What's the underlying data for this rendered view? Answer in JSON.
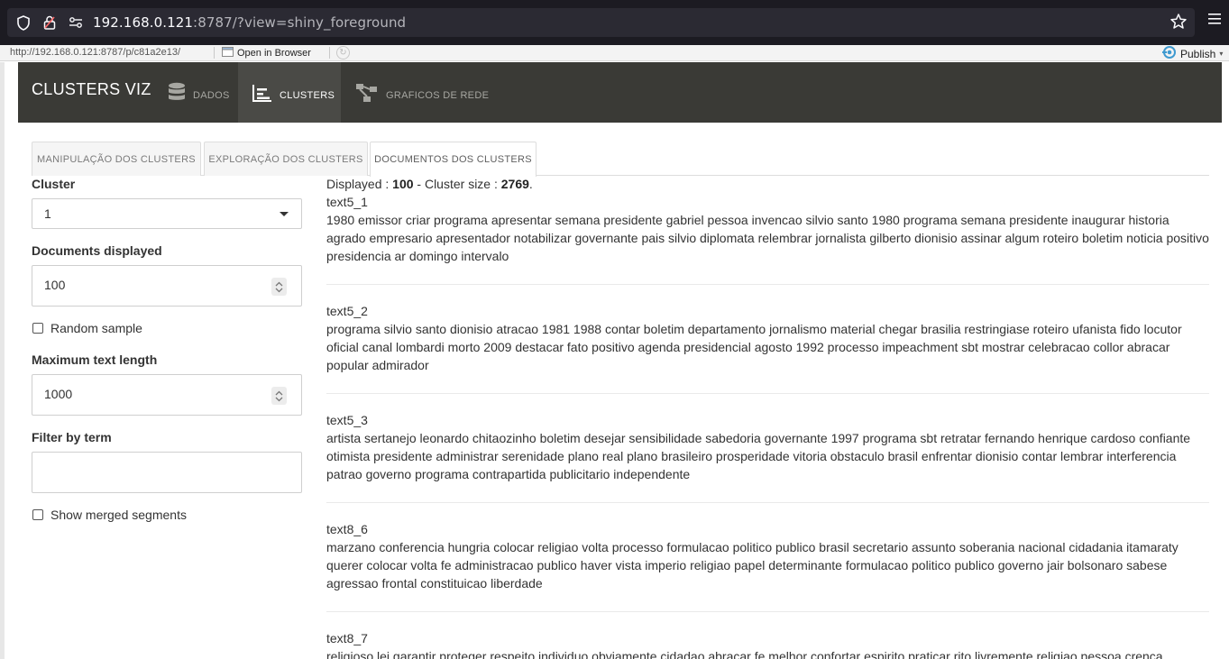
{
  "browser": {
    "url_host": "192.168.0.121",
    "url_rest": ":8787/?view=shiny_foreground"
  },
  "viewer": {
    "url": "http://192.168.0.121:8787/p/c81a2e13/",
    "open_in_browser": "Open in Browser",
    "publish": "Publish"
  },
  "navbar": {
    "brand": "CLUSTERS VIZ",
    "items": [
      {
        "label": "DADOS",
        "icon": "database-icon"
      },
      {
        "label": "CLUSTERS",
        "icon": "bar-chart-icon"
      },
      {
        "label": "GRAFICOS DE REDE",
        "icon": "network-icon"
      }
    ]
  },
  "tabs": [
    {
      "label": "MANIPULAÇÃO DOS CLUSTERS"
    },
    {
      "label": "EXPLORAÇÃO DOS CLUSTERS"
    },
    {
      "label": "DOCUMENTOS DOS CLUSTERS"
    }
  ],
  "sidebar": {
    "cluster_label": "Cluster",
    "cluster_value": "1",
    "docs_label": "Documents displayed",
    "docs_value": "100",
    "random_label": "Random sample",
    "maxlen_label": "Maximum text length",
    "maxlen_value": "1000",
    "filter_label": "Filter by term",
    "filter_value": "",
    "merged_label": "Show merged segments"
  },
  "summary": {
    "prefix": "Displayed : ",
    "displayed": "100",
    "middle": " - Cluster size : ",
    "size": "2769",
    "suffix": "."
  },
  "documents": [
    {
      "name": "text5_1",
      "text": "1980 emissor criar programa apresentar semana presidente gabriel pessoa invencao silvio santo 1980 programa semana presidente inaugurar historia agrado empresario apresentador notabilizar governante pais silvio diplomata relembrar jornalista gilberto dionisio assinar algum roteiro boletim noticia positivo presidencia ar domingo intervalo"
    },
    {
      "name": "text5_2",
      "text": "programa silvio santo dionisio atracao 1981 1988 contar boletim departamento jornalismo material chegar brasilia restringiase roteiro ufanista fido locutor oficial canal lombardi morto 2009 destacar fato positivo agenda presidencial agosto 1992 processo impeachment sbt mostrar celebracao collor abracar popular admirador"
    },
    {
      "name": "text5_3",
      "text": "artista sertanejo leonardo chitaozinho boletim desejar sensibilidade sabedoria governante 1997 programa sbt retratar fernando henrique cardoso confiante otimista presidente administrar serenidade plano real plano brasileiro prosperidade vitoria obstaculo brasil enfrentar dionisio contar lembrar interferencia patrao governo programa contrapartida publicitario independente"
    },
    {
      "name": "text8_6",
      "text": "marzano conferencia hungria colocar religiao volta processo formulacao politico publico brasil secretario assunto soberania nacional cidadania itamaraty querer colocar volta fe administracao publico haver vista imperio religiao papel determinante formulacao politico publico governo jair bolsonaro sabese agressao frontal constituicao liberdade"
    },
    {
      "name": "text8_7",
      "text": "religioso lei garantir proteger respeito individuo obviamente cidadao abracar fe melhor confortar espirito praticar rito livremente religiao pessoa crenca"
    }
  ]
}
